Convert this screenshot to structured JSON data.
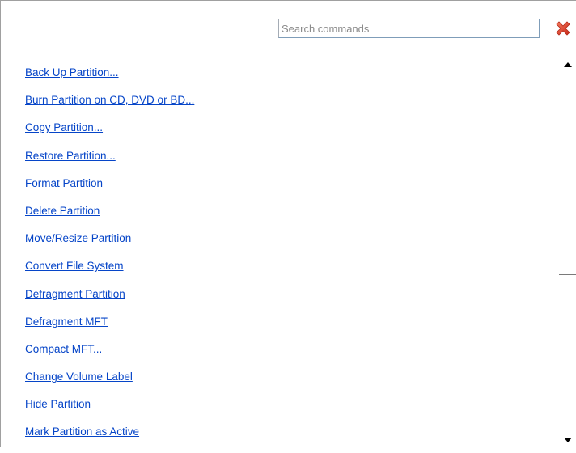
{
  "search": {
    "placeholder": "Search commands",
    "value": ""
  },
  "close_button": {
    "icon": "close-icon",
    "color": "#e8412a"
  },
  "commands": [
    {
      "label": "Back Up Partition..."
    },
    {
      "label": "Burn Partition on CD, DVD or BD..."
    },
    {
      "label": "Copy Partition..."
    },
    {
      "label": "Restore Partition..."
    },
    {
      "label": "Format Partition"
    },
    {
      "label": "Delete Partition"
    },
    {
      "label": "Move/Resize Partition"
    },
    {
      "label": "Convert File System"
    },
    {
      "label": "Defragment Partition"
    },
    {
      "label": "Defragment MFT"
    },
    {
      "label": "Compact MFT..."
    },
    {
      "label": "Change Volume Label"
    },
    {
      "label": "Hide Partition"
    },
    {
      "label": "Mark Partition as Active"
    }
  ],
  "scrollbar": {
    "up_icon": "scroll-up-arrow-icon",
    "down_icon": "scroll-down-arrow-icon"
  },
  "colors": {
    "link": "#0645c8",
    "border": "#a0a0a0"
  }
}
